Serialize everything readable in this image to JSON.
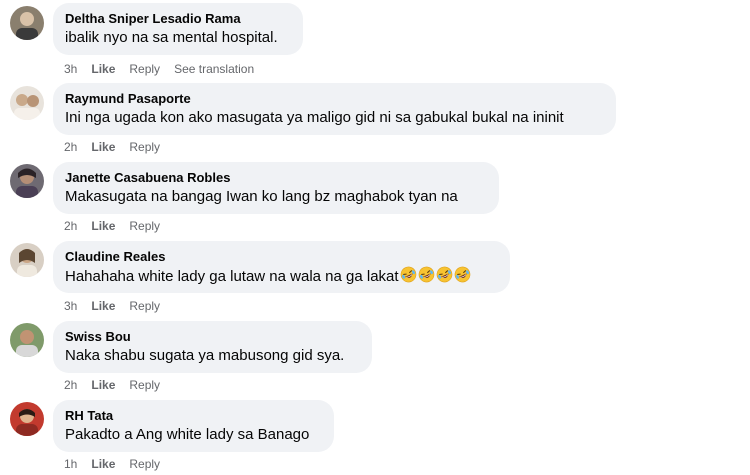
{
  "comments": [
    {
      "name": "Deltha Sniper Lesadio Rama",
      "text": "ibalik nyo na sa mental hospital.",
      "time": "3h",
      "like": "Like",
      "reply": "Reply",
      "extra": "See translation",
      "avatar": "avatar-photo"
    },
    {
      "name": "Raymund Pasaporte",
      "text": "Ini nga ugada kon ako masugata ya maligo gid ni sa gabukal bukal na ininit",
      "time": "2h",
      "like": "Like",
      "reply": "Reply",
      "extra": "",
      "avatar": "avatar-photo"
    },
    {
      "name": "Janette Casabuena Robles",
      "text": "Makasugata na bangag Iwan ko lang bz maghabok tyan na",
      "time": "2h",
      "like": "Like",
      "reply": "Reply",
      "extra": "",
      "avatar": "avatar-photo"
    },
    {
      "name": "Claudine Reales",
      "text": "Hahahaha white lady ga lutaw na wala na ga lakat",
      "time": "3h",
      "like": "Like",
      "reply": "Reply",
      "extra": "",
      "avatar": "avatar-photo",
      "emoji_count": 4,
      "emoji_name": "rolling-on-floor-laughing-emoji"
    },
    {
      "name": "Swiss Bou",
      "text": "Naka shabu sugata ya mabusong gid sya.",
      "time": "2h",
      "like": "Like",
      "reply": "Reply",
      "extra": "",
      "avatar": "avatar-photo"
    },
    {
      "name": "RH Tata",
      "text": "Pakadto a Ang white lady sa Banago",
      "time": "1h",
      "like": "Like",
      "reply": "Reply",
      "extra": "",
      "avatar": "avatar-photo"
    }
  ],
  "colors": {
    "bubble": "#f0f2f5",
    "meta": "#65676b",
    "text": "#050505"
  }
}
